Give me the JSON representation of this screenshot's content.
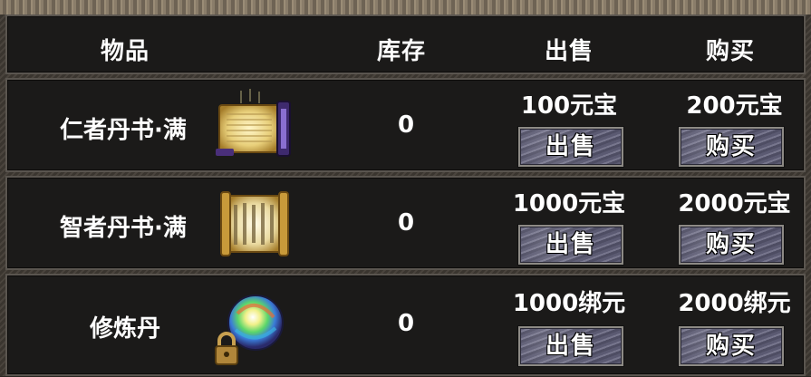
{
  "header": {
    "item": "物品",
    "stock": "库存",
    "sell": "出售",
    "buy": "购买"
  },
  "items": [
    {
      "name": "仁者丹书·满",
      "icon": "scroll-icon",
      "stock": "0",
      "sell_price": "100元宝",
      "buy_price": "200元宝",
      "sell_label": "出售",
      "buy_label": "购买"
    },
    {
      "name": "智者丹书·满",
      "icon": "scroll-icon",
      "stock": "0",
      "sell_price": "1000元宝",
      "buy_price": "2000元宝",
      "sell_label": "出售",
      "buy_label": "购买"
    },
    {
      "name": "修炼丹",
      "icon": "rainbow-orb-locked-icon",
      "stock": "0",
      "sell_price": "1000绑元",
      "buy_price": "2000绑元",
      "sell_label": "出售",
      "buy_label": "购买"
    }
  ],
  "colors": {
    "panel": "#1b1a19",
    "border": "#5a554f",
    "button": "#6a6982",
    "text": "#ffffff"
  }
}
